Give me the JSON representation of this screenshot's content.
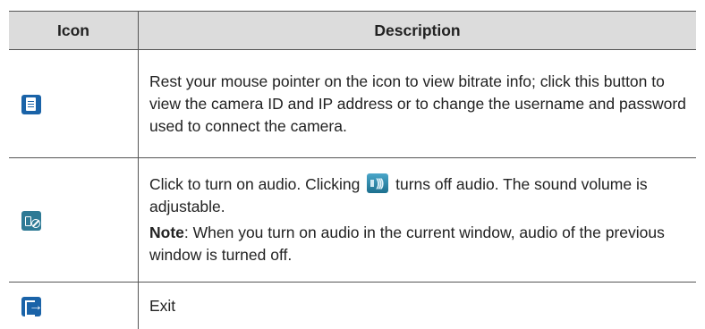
{
  "table": {
    "headers": {
      "icon": "Icon",
      "description": "Description"
    },
    "rows": [
      {
        "icon": "document-icon",
        "description": "Rest your mouse pointer on the icon to view bitrate info; click this button to view the camera ID and IP address or to change the username and password used to connect the camera."
      },
      {
        "icon": "mute-icon",
        "desc_before": "Click to turn on audio. Clicking",
        "inline_icon": "speaker-on-icon",
        "desc_after": "turns off audio. The sound volume is adjustable.",
        "note_label": "Note",
        "note_text": ": When you turn on audio in the current window, audio of the previous window is turned off."
      },
      {
        "icon": "exit-icon",
        "description": "Exit"
      }
    ]
  },
  "colors": {
    "header_bg": "#dcdcdc",
    "icon_blue": "#1a63a8",
    "border": "#555555"
  }
}
